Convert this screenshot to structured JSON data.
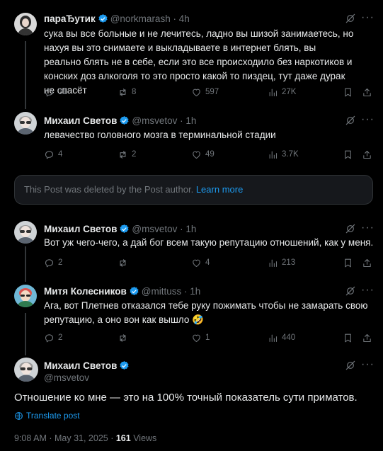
{
  "colors": {
    "background": "#000000",
    "text": "#e7e9ea",
    "muted": "#71767b",
    "accent": "#1d9bf0",
    "verified": "#1d9bf0",
    "card": "#16181c"
  },
  "posts": [
    {
      "name": "параЂутик",
      "handle": "@norkmarash",
      "time": "4h",
      "text": "сука вы все больные и не лечитесь,  ладно вы шизой занимаетесь, но нахуя вы это снимаете и выкладываете в интернет блять, вы реально блять не в себе, если это все происходило без наркотиков и конских доз алкоголя то это просто какой то пиздец, тут даже дурак не спасёт",
      "replies": "31",
      "reposts": "8",
      "likes": "597",
      "views": "27K"
    },
    {
      "name": "Михаил Светов",
      "handle": "@msvetov",
      "time": "1h",
      "text": "левачество головного мозга в терминальной стадии",
      "replies": "4",
      "reposts": "2",
      "likes": "49",
      "views": "3.7K"
    },
    {
      "name": "Михаил Светов",
      "handle": "@msvetov",
      "time": "1h",
      "text": "Вот уж чего-чего, а дай бог всем такую репутацию отношений, как у меня.",
      "replies": "2",
      "reposts": "",
      "likes": "4",
      "views": "213"
    },
    {
      "name": "Митя Колесников",
      "handle": "@mittuss",
      "time": "1h",
      "text": "Ага, вот Плетнев отказался тебе руку пожимать чтобы не замарать свою репутацию, а оно вон как вышло 🤣",
      "replies": "2",
      "reposts": "",
      "likes": "1",
      "views": "440"
    }
  ],
  "deleted_notice": {
    "text": "This Post was deleted by the Post author.",
    "link": "Learn more"
  },
  "main_post": {
    "name": "Михаил Светов",
    "handle": "@msvetov",
    "text": "Отношение ко мне — это на 100% точный показатель сути приматов.",
    "translate": "Translate post",
    "time": "9:08 AM",
    "date": "May 31, 2025",
    "views_count": "161",
    "views_label": "Views"
  },
  "icons": [
    "grok-icon",
    "more-icon",
    "reply-icon",
    "repost-icon",
    "like-icon",
    "views-icon",
    "bookmark-icon",
    "share-icon",
    "verified-badge-icon",
    "globe-icon"
  ]
}
